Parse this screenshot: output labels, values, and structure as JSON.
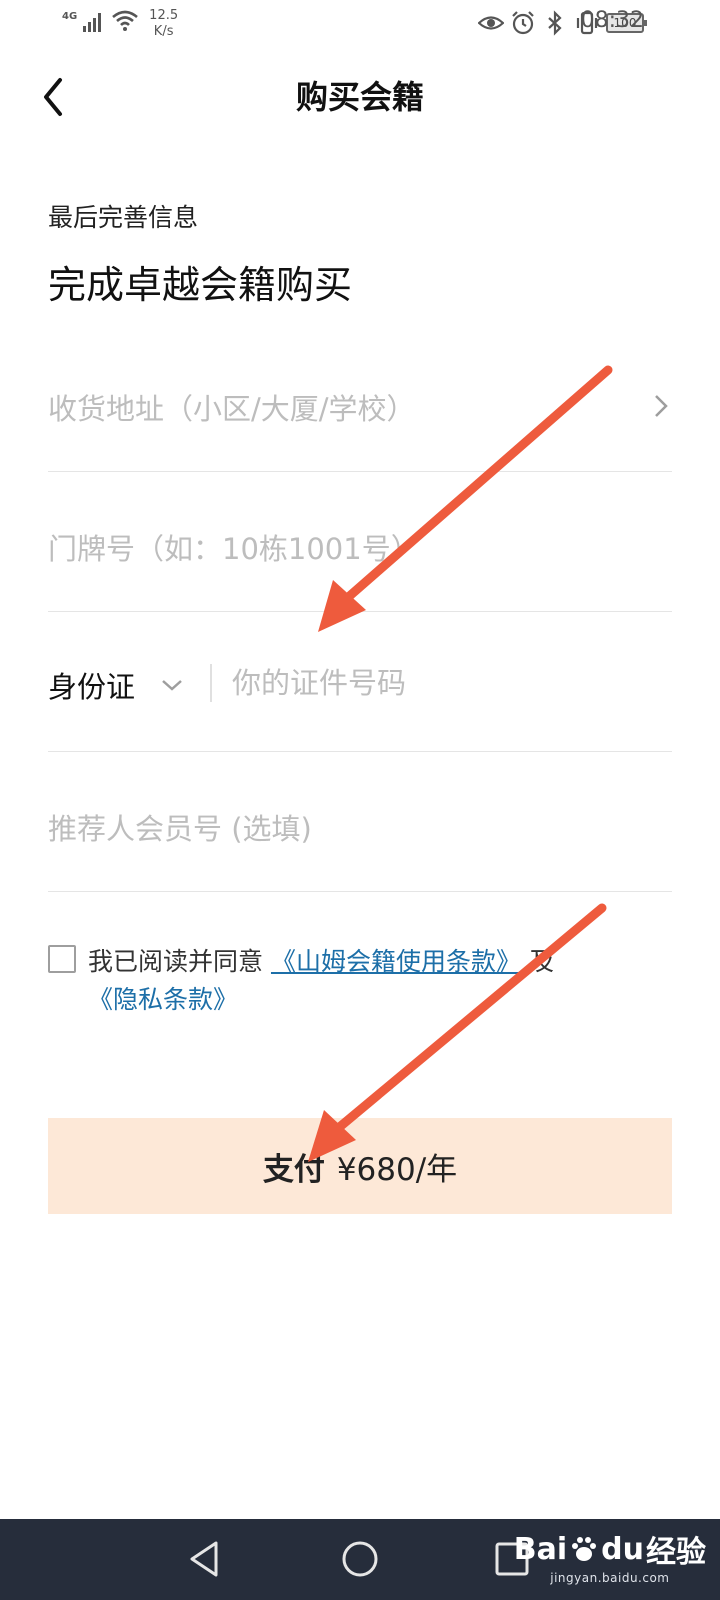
{
  "status_bar": {
    "network": "4G",
    "speed_value": "12.5",
    "speed_unit": "K/s",
    "battery": "100",
    "time": "08:32"
  },
  "header": {
    "title": "购买会籍"
  },
  "intro": {
    "subtitle": "最后完善信息",
    "headline": "完成卓越会籍购买"
  },
  "form": {
    "address_placeholder": "收货地址（小区/大厦/学校）",
    "door_placeholder": "门牌号（如：10栋1001号）",
    "id_type": "身份证",
    "id_placeholder": "你的证件号码",
    "referrer_placeholder": "推荐人会员号 (选填)"
  },
  "agreement": {
    "prefix": "我已阅读并同意",
    "terms_link": "《山姆会籍使用条款》",
    "connector": "及",
    "privacy_link": "《隐私条款》",
    "checked": false
  },
  "pay_button": {
    "label": "支付",
    "price": "¥680/年"
  },
  "watermark": {
    "brand_a": "Bai",
    "brand_b": "du",
    "brand_c": "经验",
    "url": "jingyan.baidu.com"
  },
  "colors": {
    "link": "#1d6fa8",
    "pay_button_bg": "#fde8d7",
    "nav_bar_bg": "#262d3b",
    "arrow": "#ee5b3d",
    "placeholder": "#bdbdbd"
  }
}
